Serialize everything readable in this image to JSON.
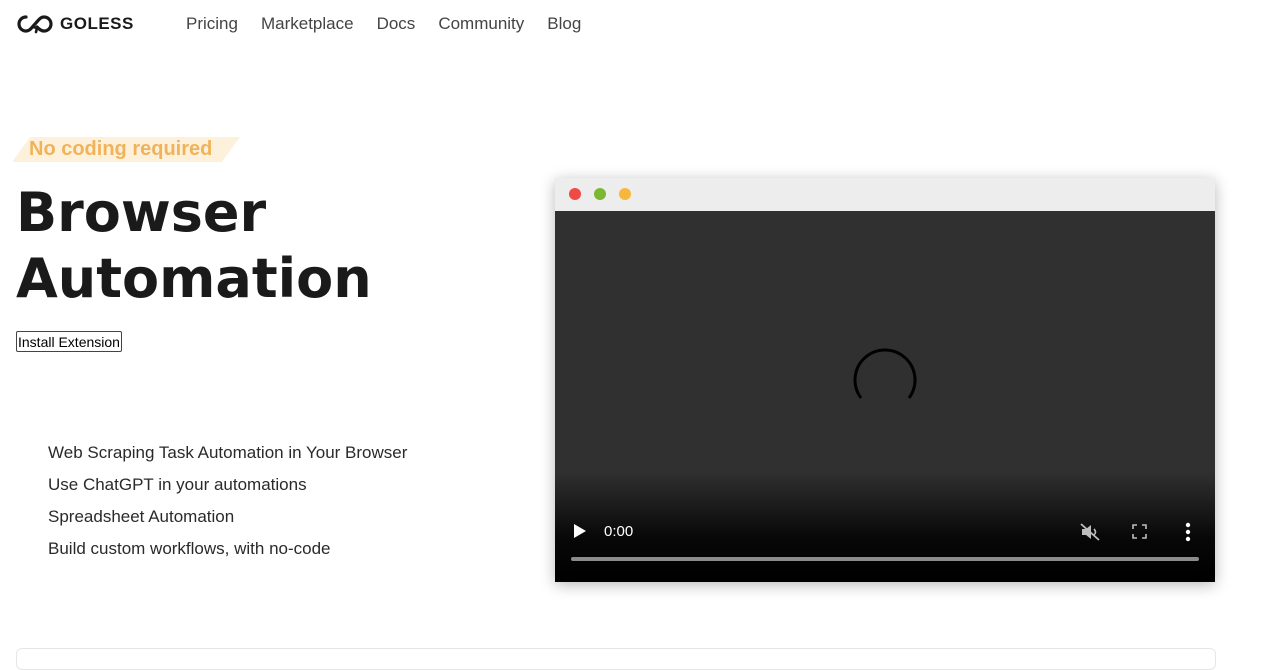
{
  "brand": {
    "name": "GOLESS",
    "logo_icon": "infinity-arrow-icon"
  },
  "nav": {
    "items": [
      "Pricing",
      "Marketplace",
      "Docs",
      "Community",
      "Blog"
    ]
  },
  "hero": {
    "badge": "No coding required",
    "title_line1": "Browser",
    "title_line2": "Automation",
    "cta_label": "Install Extension",
    "features": [
      "Web Scraping Task Automation in Your Browser",
      "Use ChatGPT in your automations",
      "Spreadsheet Automation",
      "Build custom workflows, with no-code"
    ]
  },
  "video": {
    "time": "0:00",
    "progress": 0,
    "icons": [
      "play-icon",
      "mute-icon",
      "fullscreen-icon",
      "more-options-icon",
      "loading-spinner-icon"
    ]
  },
  "colors": {
    "badge_text": "#f0b35a",
    "badge_bg": "#fdf1dc",
    "dot_red": "#f04a45",
    "dot_green": "#7cb731",
    "dot_yellow": "#f6b73c",
    "video_bg": "#303030"
  }
}
